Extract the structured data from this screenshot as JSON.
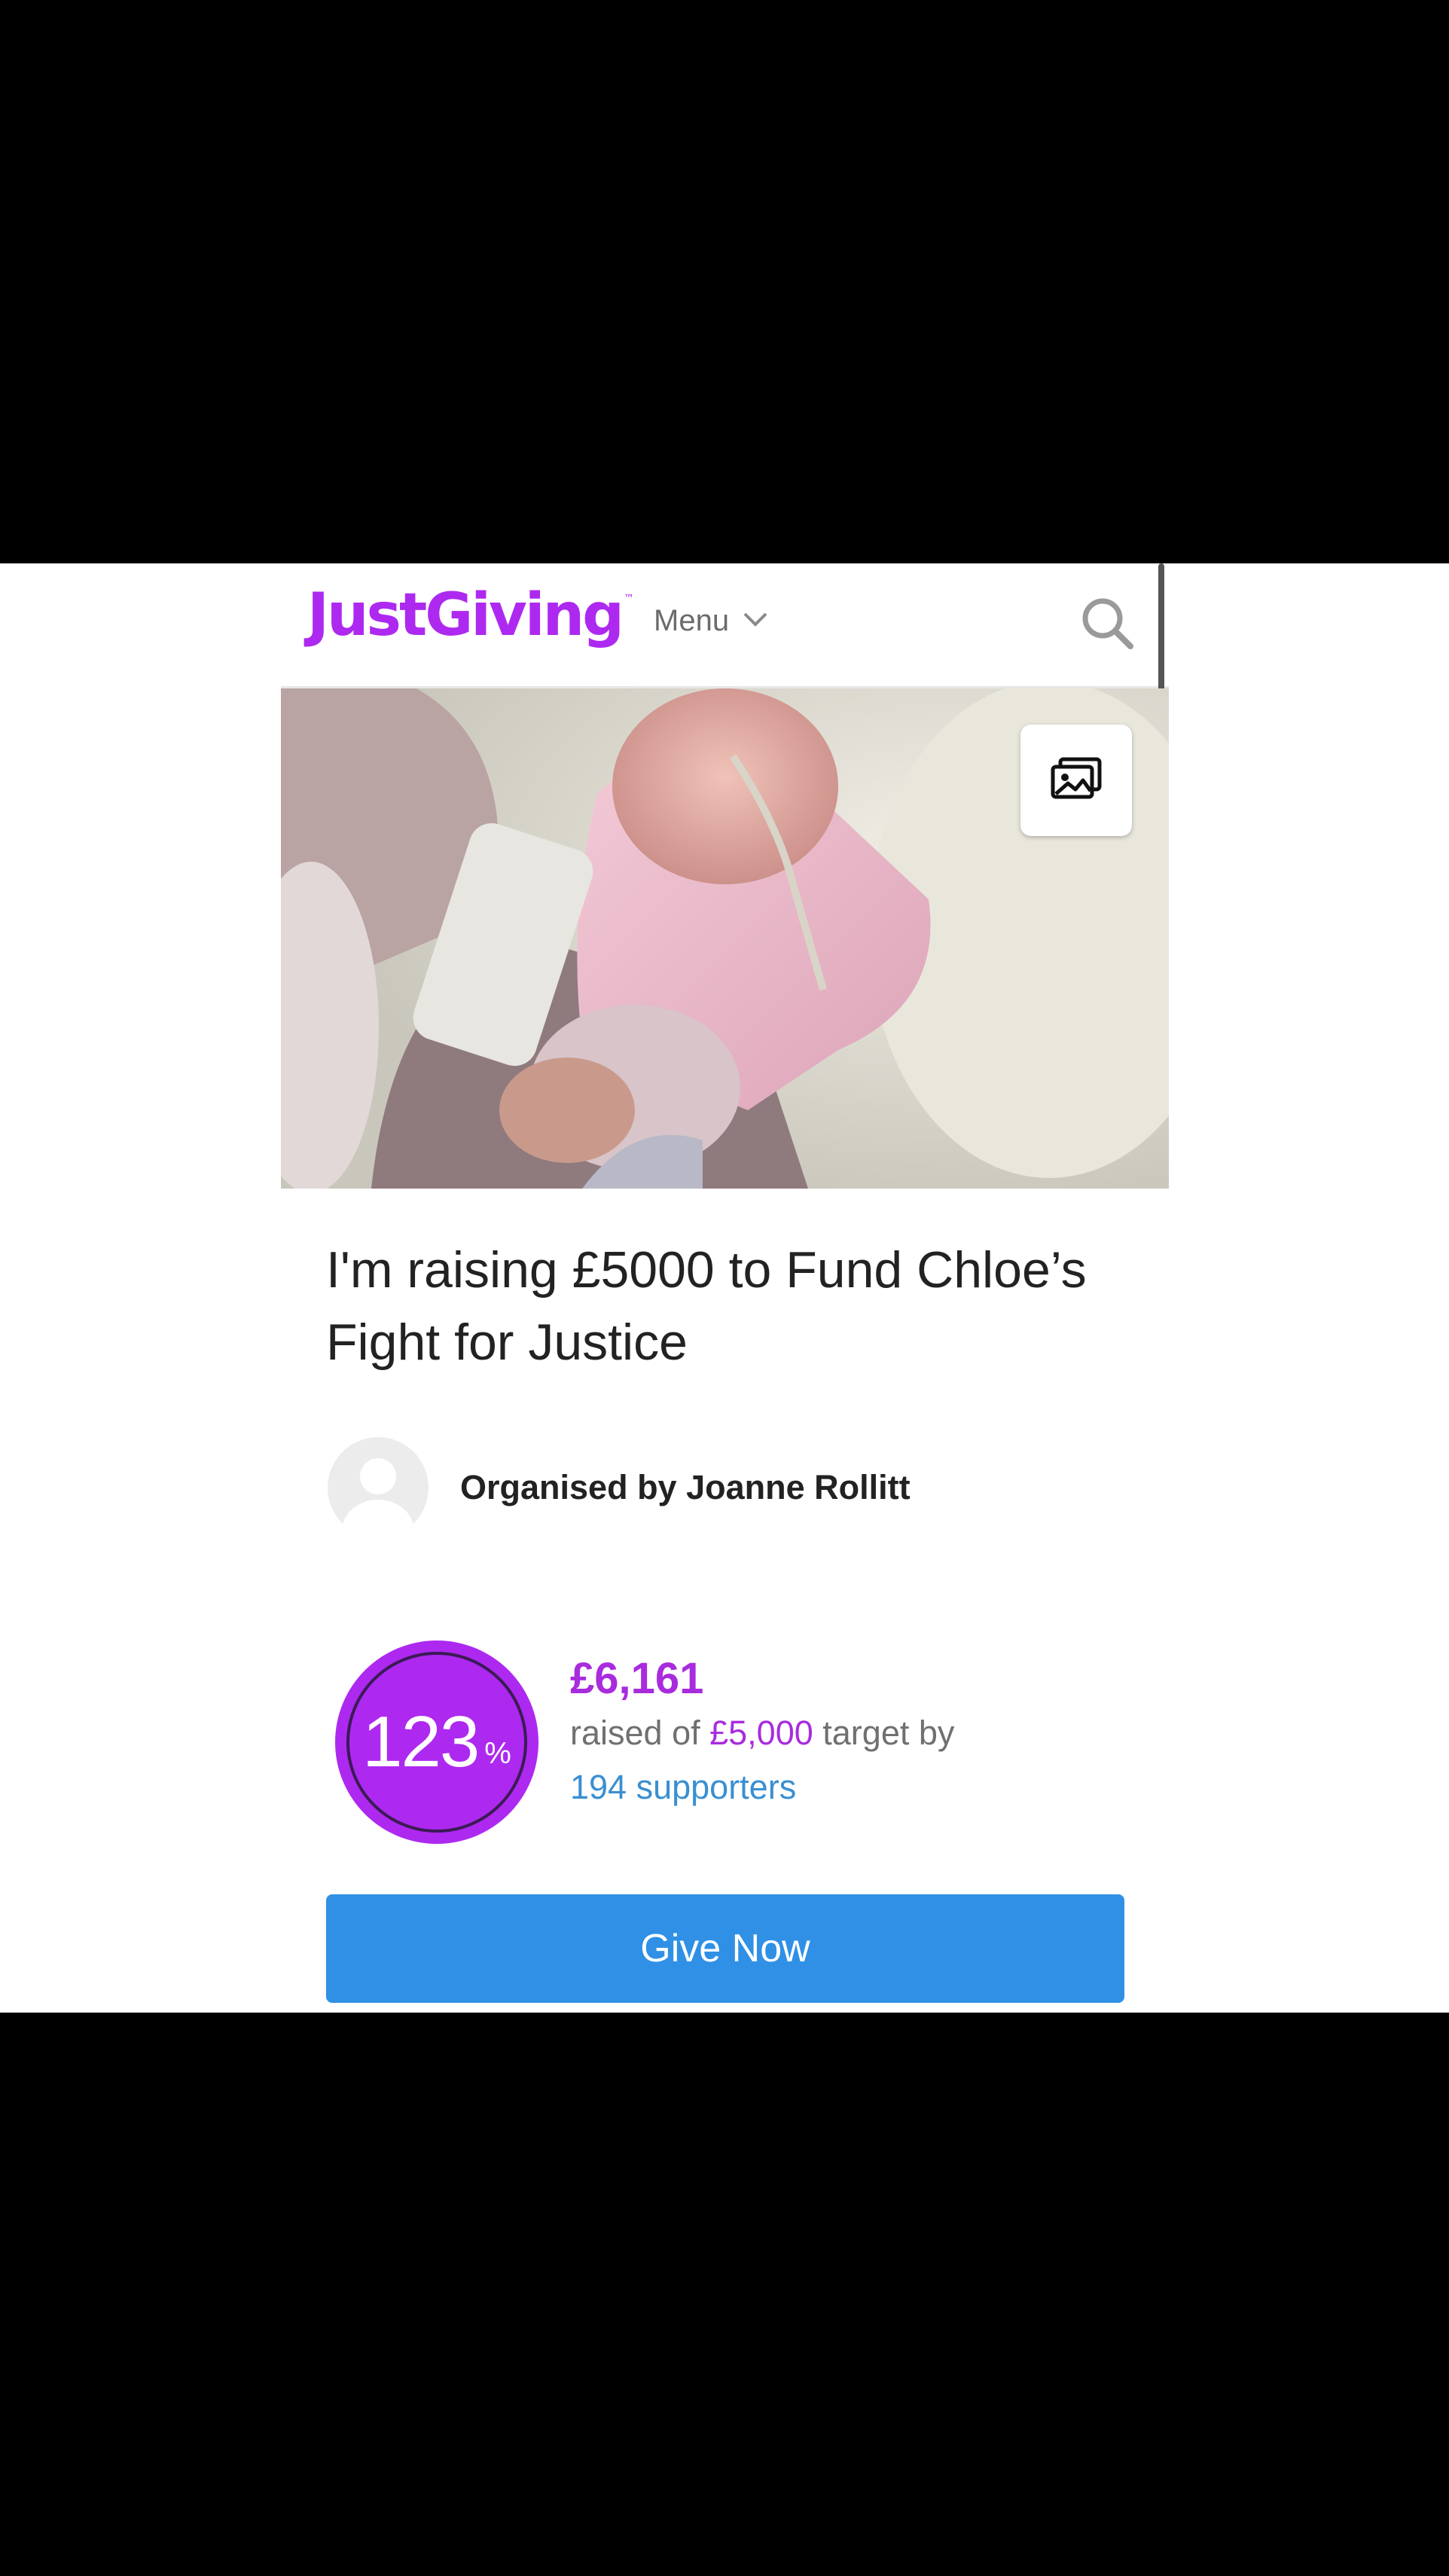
{
  "brand": {
    "logo_text": "JustGiving",
    "trademark": "™",
    "color": "#ad29f0"
  },
  "nav": {
    "menu_label": "Menu",
    "search_icon": "search-icon",
    "menu_chevron_icon": "chevron-down-icon"
  },
  "hero": {
    "gallery_icon": "image-gallery-icon",
    "photo": "newborn baby in hospital bed with feeding tube"
  },
  "page": {
    "title": "I'm raising £5000 to Fund Chloe’s Fight for Justice"
  },
  "organiser": {
    "label": "Organised by Joanne Rollitt"
  },
  "fundraising": {
    "percent": "123",
    "percent_sign": "%",
    "percent_value": 1.23,
    "raised": "£6,161",
    "raised_prefix": "raised of",
    "target": "£5,000",
    "target_suffix": "target by",
    "supporters": "194 supporters"
  },
  "actions": {
    "give_label": "Give Now"
  },
  "colors": {
    "accent": "#ad29f0",
    "button": "#2f90e6",
    "link": "#3a8fd1"
  }
}
